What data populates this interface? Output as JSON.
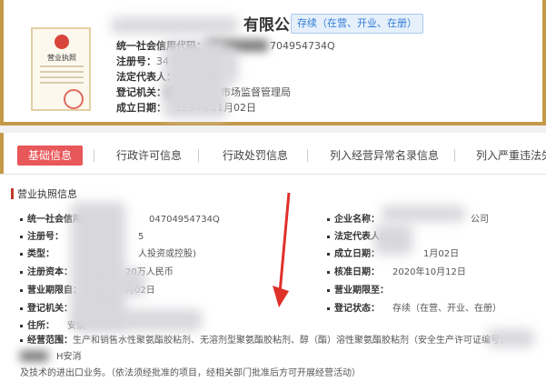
{
  "header": {
    "license_thumb_title": "营业执照",
    "company_name_visible": "有限公司",
    "status_tag": "存续（在营、开业、在册）",
    "rows": [
      {
        "label": "统一社会信用代码：",
        "value": "704954734Q"
      },
      {
        "label": "注册号：",
        "value": "34"
      },
      {
        "label": "法定代表人：",
        "value": ""
      },
      {
        "label": "登记机关：",
        "value": "市场监督管理局"
      },
      {
        "label": "成立日期：",
        "value": "1994年11月02日"
      }
    ]
  },
  "tabs": [
    {
      "label": "基础信息",
      "active": true
    },
    {
      "label": "行政许可信息",
      "active": false
    },
    {
      "label": "行政处罚信息",
      "active": false
    },
    {
      "label": "列入经营异常名录信息",
      "active": false
    },
    {
      "label": "列入严重违法失",
      "active": false
    }
  ],
  "section": {
    "title": "营业执照信息",
    "left_fields": [
      {
        "label": "统一社会信用代码：",
        "value": "04704954734Q"
      },
      {
        "label": "注册号：",
        "value": "5"
      },
      {
        "label": "类型：",
        "value": "人投资或控股)"
      },
      {
        "label": "注册资本：",
        "value": "20万人民币"
      },
      {
        "label": "营业期限自：",
        "value": "月02日"
      },
      {
        "label": "登记机关：",
        "value": ""
      },
      {
        "label": "住所：",
        "value": "安徽"
      }
    ],
    "right_fields": [
      {
        "label": "企业名称：",
        "value": "公司"
      },
      {
        "label": "法定代表人：",
        "value": ""
      },
      {
        "label": "成立日期：",
        "value": "1月02日"
      },
      {
        "label": "核准日期：",
        "value": "2020年10月12日"
      },
      {
        "label": "营业期限至：",
        "value": ""
      },
      {
        "label": "登记状态：",
        "value": "存续（在营、开业、在册）"
      }
    ],
    "scope_label": "经营范围：",
    "scope_text": "生产和销售水性聚氨酯胶粘剂、无溶剂型聚氨酯胶粘剂、醇（酯）溶性聚氨酯胶粘剂（安全生产许可证编号：",
    "scope_text_tail": "H安消",
    "scope_line2": "及技术的进出口业务。（依法须经批准的项目，经相关部门批准后方可开展经营活动）"
  },
  "colors": {
    "accent_gold": "#c49a49",
    "active_tab": "#e8575a",
    "status_blue": "#2f7bd6",
    "arrow_red": "#e0302a"
  }
}
